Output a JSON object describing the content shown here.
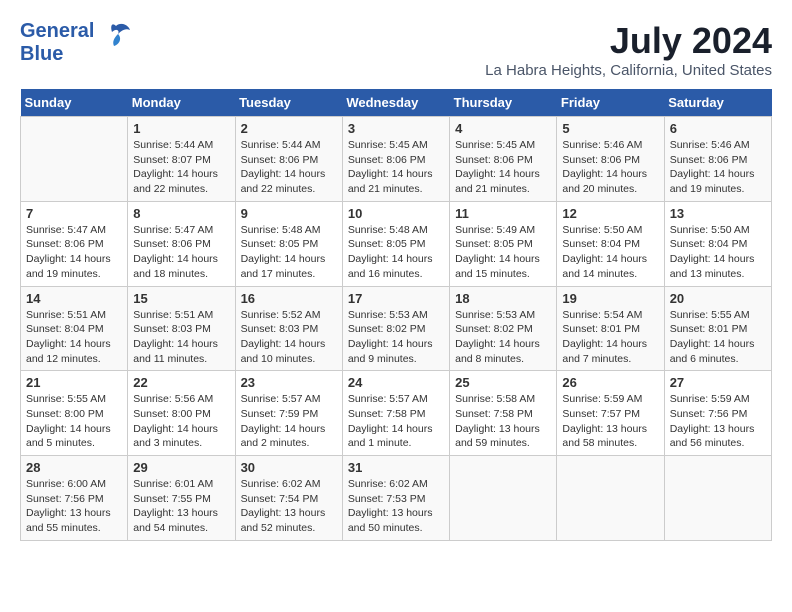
{
  "header": {
    "logo_line1": "General",
    "logo_line2": "Blue",
    "month_year": "July 2024",
    "location": "La Habra Heights, California, United States"
  },
  "days_of_week": [
    "Sunday",
    "Monday",
    "Tuesday",
    "Wednesday",
    "Thursday",
    "Friday",
    "Saturday"
  ],
  "weeks": [
    [
      {
        "day": "",
        "info": ""
      },
      {
        "day": "1",
        "info": "Sunrise: 5:44 AM\nSunset: 8:07 PM\nDaylight: 14 hours\nand 22 minutes."
      },
      {
        "day": "2",
        "info": "Sunrise: 5:44 AM\nSunset: 8:06 PM\nDaylight: 14 hours\nand 22 minutes."
      },
      {
        "day": "3",
        "info": "Sunrise: 5:45 AM\nSunset: 8:06 PM\nDaylight: 14 hours\nand 21 minutes."
      },
      {
        "day": "4",
        "info": "Sunrise: 5:45 AM\nSunset: 8:06 PM\nDaylight: 14 hours\nand 21 minutes."
      },
      {
        "day": "5",
        "info": "Sunrise: 5:46 AM\nSunset: 8:06 PM\nDaylight: 14 hours\nand 20 minutes."
      },
      {
        "day": "6",
        "info": "Sunrise: 5:46 AM\nSunset: 8:06 PM\nDaylight: 14 hours\nand 19 minutes."
      }
    ],
    [
      {
        "day": "7",
        "info": "Sunrise: 5:47 AM\nSunset: 8:06 PM\nDaylight: 14 hours\nand 19 minutes."
      },
      {
        "day": "8",
        "info": "Sunrise: 5:47 AM\nSunset: 8:06 PM\nDaylight: 14 hours\nand 18 minutes."
      },
      {
        "day": "9",
        "info": "Sunrise: 5:48 AM\nSunset: 8:05 PM\nDaylight: 14 hours\nand 17 minutes."
      },
      {
        "day": "10",
        "info": "Sunrise: 5:48 AM\nSunset: 8:05 PM\nDaylight: 14 hours\nand 16 minutes."
      },
      {
        "day": "11",
        "info": "Sunrise: 5:49 AM\nSunset: 8:05 PM\nDaylight: 14 hours\nand 15 minutes."
      },
      {
        "day": "12",
        "info": "Sunrise: 5:50 AM\nSunset: 8:04 PM\nDaylight: 14 hours\nand 14 minutes."
      },
      {
        "day": "13",
        "info": "Sunrise: 5:50 AM\nSunset: 8:04 PM\nDaylight: 14 hours\nand 13 minutes."
      }
    ],
    [
      {
        "day": "14",
        "info": "Sunrise: 5:51 AM\nSunset: 8:04 PM\nDaylight: 14 hours\nand 12 minutes."
      },
      {
        "day": "15",
        "info": "Sunrise: 5:51 AM\nSunset: 8:03 PM\nDaylight: 14 hours\nand 11 minutes."
      },
      {
        "day": "16",
        "info": "Sunrise: 5:52 AM\nSunset: 8:03 PM\nDaylight: 14 hours\nand 10 minutes."
      },
      {
        "day": "17",
        "info": "Sunrise: 5:53 AM\nSunset: 8:02 PM\nDaylight: 14 hours\nand 9 minutes."
      },
      {
        "day": "18",
        "info": "Sunrise: 5:53 AM\nSunset: 8:02 PM\nDaylight: 14 hours\nand 8 minutes."
      },
      {
        "day": "19",
        "info": "Sunrise: 5:54 AM\nSunset: 8:01 PM\nDaylight: 14 hours\nand 7 minutes."
      },
      {
        "day": "20",
        "info": "Sunrise: 5:55 AM\nSunset: 8:01 PM\nDaylight: 14 hours\nand 6 minutes."
      }
    ],
    [
      {
        "day": "21",
        "info": "Sunrise: 5:55 AM\nSunset: 8:00 PM\nDaylight: 14 hours\nand 5 minutes."
      },
      {
        "day": "22",
        "info": "Sunrise: 5:56 AM\nSunset: 8:00 PM\nDaylight: 14 hours\nand 3 minutes."
      },
      {
        "day": "23",
        "info": "Sunrise: 5:57 AM\nSunset: 7:59 PM\nDaylight: 14 hours\nand 2 minutes."
      },
      {
        "day": "24",
        "info": "Sunrise: 5:57 AM\nSunset: 7:58 PM\nDaylight: 14 hours\nand 1 minute."
      },
      {
        "day": "25",
        "info": "Sunrise: 5:58 AM\nSunset: 7:58 PM\nDaylight: 13 hours\nand 59 minutes."
      },
      {
        "day": "26",
        "info": "Sunrise: 5:59 AM\nSunset: 7:57 PM\nDaylight: 13 hours\nand 58 minutes."
      },
      {
        "day": "27",
        "info": "Sunrise: 5:59 AM\nSunset: 7:56 PM\nDaylight: 13 hours\nand 56 minutes."
      }
    ],
    [
      {
        "day": "28",
        "info": "Sunrise: 6:00 AM\nSunset: 7:56 PM\nDaylight: 13 hours\nand 55 minutes."
      },
      {
        "day": "29",
        "info": "Sunrise: 6:01 AM\nSunset: 7:55 PM\nDaylight: 13 hours\nand 54 minutes."
      },
      {
        "day": "30",
        "info": "Sunrise: 6:02 AM\nSunset: 7:54 PM\nDaylight: 13 hours\nand 52 minutes."
      },
      {
        "day": "31",
        "info": "Sunrise: 6:02 AM\nSunset: 7:53 PM\nDaylight: 13 hours\nand 50 minutes."
      },
      {
        "day": "",
        "info": ""
      },
      {
        "day": "",
        "info": ""
      },
      {
        "day": "",
        "info": ""
      }
    ]
  ]
}
